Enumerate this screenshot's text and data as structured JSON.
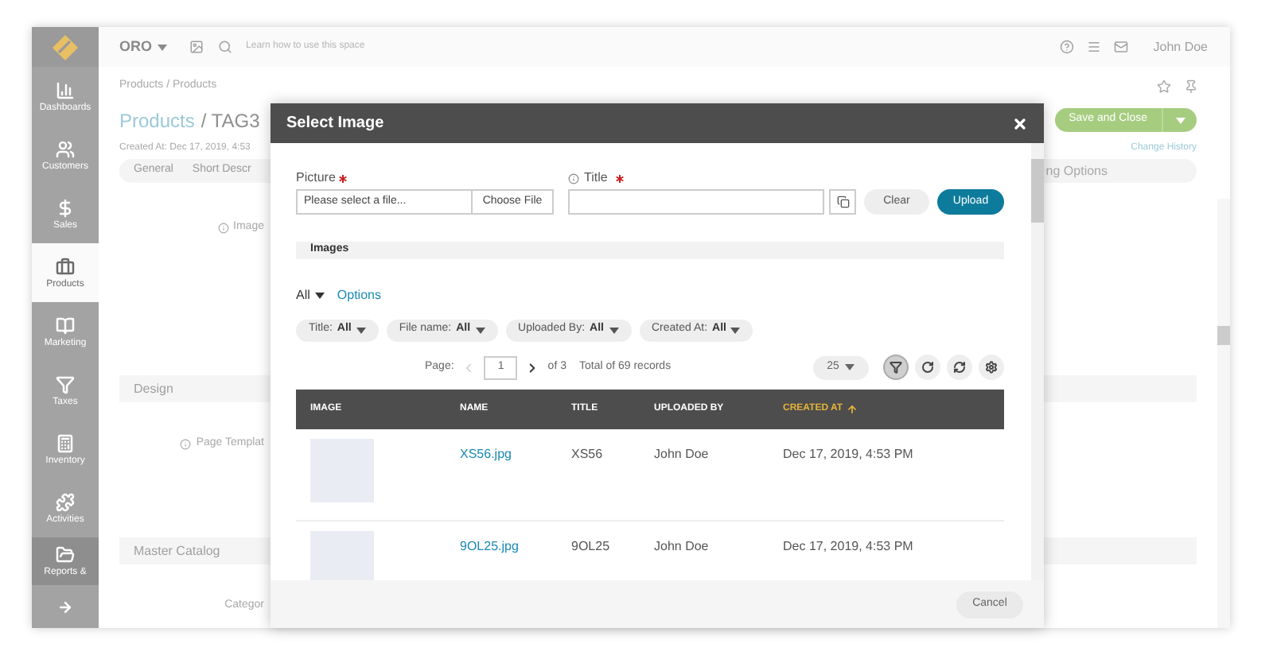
{
  "app_bar": {
    "brand": "ORO",
    "help_hint": "Learn how to use this space",
    "user": "John Doe"
  },
  "sidebar": {
    "items": [
      {
        "label": "Dashboards",
        "selected": false
      },
      {
        "label": "Customers",
        "selected": false
      },
      {
        "label": "Sales",
        "selected": false
      },
      {
        "label": "Products",
        "selected": true
      },
      {
        "label": "Marketing",
        "selected": false
      },
      {
        "label": "Taxes",
        "selected": false
      },
      {
        "label": "Inventory",
        "selected": false
      },
      {
        "label": "Activities",
        "selected": false
      },
      {
        "label": "Reports &",
        "selected": false
      }
    ]
  },
  "page": {
    "breadcrumb": "Products / Products",
    "title_link": "Products",
    "title_rest": "/ TAG3",
    "created": "Created At: Dec 17, 2019, 4:53",
    "save_button": "Save and Close",
    "change_history": "Change History",
    "tabs": [
      {
        "label": "General",
        "selected": false
      },
      {
        "label": "Short Descr",
        "selected": false
      },
      {
        "label": "ng Options",
        "selected": false
      }
    ],
    "rows": [
      {
        "kind": "field",
        "label": "Image",
        "info": true
      },
      {
        "kind": "section",
        "label": "Design"
      },
      {
        "kind": "field",
        "label": "Page Templat",
        "info": true
      },
      {
        "kind": "section",
        "label": "Master Catalog"
      },
      {
        "kind": "field",
        "label": "Categor",
        "info": false
      }
    ]
  },
  "dialog": {
    "title": "Select Image",
    "picture": {
      "label": "Picture",
      "required": true,
      "placeholder": "Please select a file...",
      "button": "Choose File"
    },
    "title_field": {
      "label": "Title",
      "required": true,
      "info": true
    },
    "clear_button": "Clear",
    "upload_button": "Upload",
    "section": "Images",
    "view": "All",
    "options_link": "Options",
    "filters": [
      {
        "label": "Title:",
        "value": "All"
      },
      {
        "label": "File name:",
        "value": "All"
      },
      {
        "label": "Uploaded By:",
        "value": "All"
      },
      {
        "label": "Created At:",
        "value": "All"
      }
    ],
    "pagination": {
      "label": "Page:",
      "page": "1",
      "of": "of 3",
      "total": "Total of 69 records",
      "per_page": "25"
    },
    "tools": [
      {
        "kind": "filter",
        "selected": true
      },
      {
        "kind": "reload",
        "selected": false
      },
      {
        "kind": "sync",
        "selected": false
      },
      {
        "kind": "settings",
        "selected": false
      }
    ],
    "table": {
      "columns": [
        {
          "label": "IMAGE",
          "sorted": false
        },
        {
          "label": "NAME",
          "sorted": false
        },
        {
          "label": "TITLE",
          "sorted": false
        },
        {
          "label": "UPLOADED BY",
          "sorted": false
        },
        {
          "label": "CREATED AT",
          "sorted": true
        }
      ],
      "rows": [
        {
          "name": "XS56.jpg",
          "title": "XS56",
          "uploaded_by": "John Doe",
          "created_at": "Dec 17, 2019, 4:53 PM"
        },
        {
          "name": "9OL25.jpg",
          "title": "9OL25",
          "uploaded_by": "John Doe",
          "created_at": "Dec 17, 2019, 4:53 PM"
        }
      ]
    },
    "cancel_button": "Cancel"
  }
}
